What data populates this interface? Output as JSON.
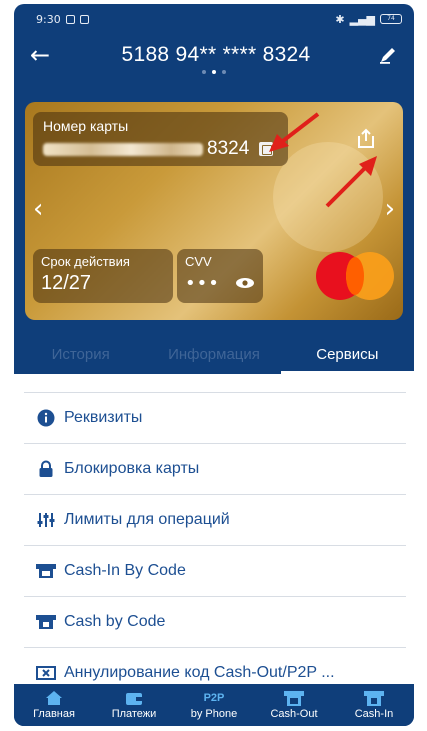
{
  "status_bar": {
    "time": "9:30",
    "network": "4G",
    "battery": "74"
  },
  "header": {
    "back_icon": "arrow-left-icon",
    "title": "5188 94** **** 8324",
    "edit_icon": "pencil-icon"
  },
  "card": {
    "number_label": "Номер карты",
    "number_last4": "8324",
    "expiry_label": "Срок действия",
    "expiry_value": "12/27",
    "cvv_label": "CVV",
    "cvv_value": "•••",
    "brand": "mastercard"
  },
  "tabs": [
    {
      "label": "История"
    },
    {
      "label": "Информация"
    },
    {
      "label": "Сервисы"
    }
  ],
  "services": [
    {
      "label": "Реквизиты",
      "icon": "info-icon"
    },
    {
      "label": "Блокировка карты",
      "icon": "lock-icon"
    },
    {
      "label": "Лимиты для операций",
      "icon": "sliders-icon"
    },
    {
      "label": "Cash-In By Code",
      "icon": "cash-in-icon"
    },
    {
      "label": "Cash by Code",
      "icon": "cash-icon"
    },
    {
      "label": "Аннулирование код Cash-Out/P2P ...",
      "icon": "cancel-code-icon"
    }
  ],
  "bottom_nav": [
    {
      "label": "Главная",
      "icon": "home-icon"
    },
    {
      "label": "Платежи",
      "icon": "wallet-icon"
    },
    {
      "label": "by Phone",
      "icon": "P2P"
    },
    {
      "label": "Cash-Out",
      "icon": "cash-out-icon"
    },
    {
      "label": "Cash-In",
      "icon": "cash-in-icon"
    }
  ],
  "colors": {
    "primary": "#0f3e7a",
    "link": "#1d4f92",
    "annotation": "#e0201a"
  }
}
